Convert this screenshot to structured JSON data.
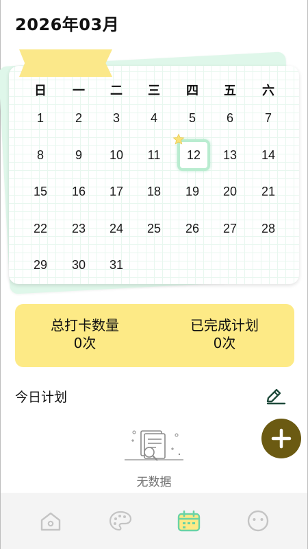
{
  "header": {
    "month_title": "2026年03月"
  },
  "calendar": {
    "weekdays": [
      "日",
      "一",
      "二",
      "三",
      "四",
      "五",
      "六"
    ],
    "days": [
      "1",
      "2",
      "3",
      "4",
      "5",
      "6",
      "7",
      "8",
      "9",
      "10",
      "11",
      "12",
      "13",
      "14",
      "15",
      "16",
      "17",
      "18",
      "19",
      "20",
      "21",
      "22",
      "23",
      "24",
      "25",
      "26",
      "27",
      "28",
      "29",
      "30",
      "31"
    ],
    "today": "12"
  },
  "stats": {
    "total_checkin_label": "总打卡数量",
    "total_checkin_value": "0次",
    "completed_plan_label": "已完成计划",
    "completed_plan_value": "0次"
  },
  "plan": {
    "title": "今日计划",
    "empty_text": "无数据"
  },
  "colors": {
    "accent_green": "#b9ecd0",
    "stats_yellow": "#fdea86",
    "add_button_brown": "#6b5a12",
    "nav_active": "#69d3a6",
    "nav_inactive": "#c4c4c4"
  },
  "nav": {
    "items": [
      "home-icon",
      "palette-icon",
      "calendar-icon",
      "face-icon"
    ],
    "active": "calendar-icon"
  }
}
